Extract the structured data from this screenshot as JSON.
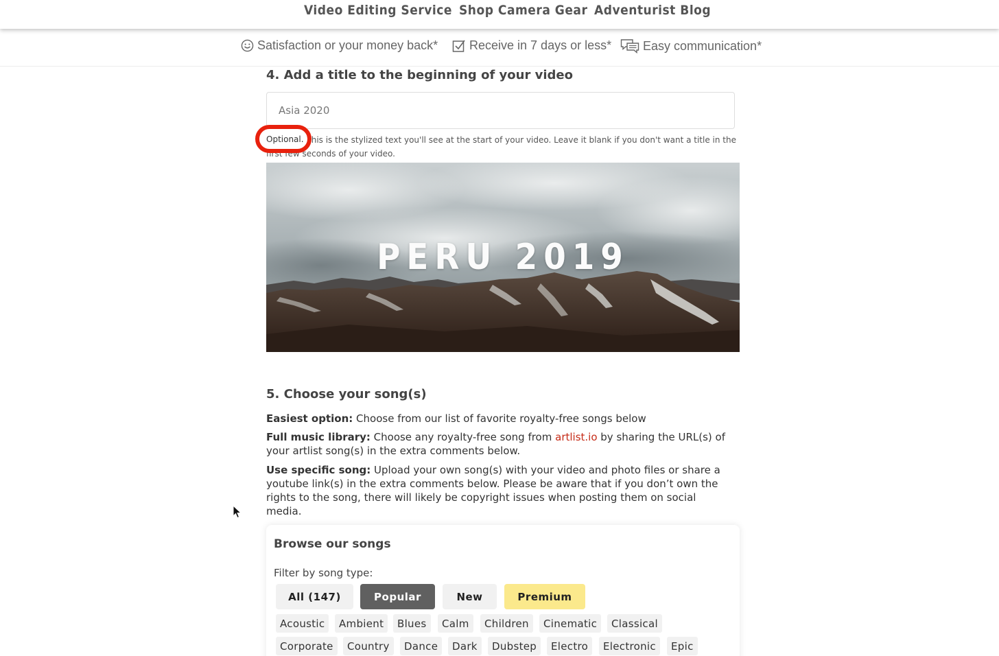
{
  "nav": {
    "items": [
      "Video Editing Service",
      "Shop Camera Gear",
      "Adventurist Blog"
    ]
  },
  "guarantees": [
    {
      "icon": "smiley-icon",
      "text": "Satisfaction or your money back*"
    },
    {
      "icon": "checkbox-icon",
      "text": "Receive in 7 days or less*"
    },
    {
      "icon": "chat-bubbles-icon",
      "text": "Easy communication*"
    }
  ],
  "section4": {
    "title": "4. Add a title to the beginning of your video",
    "input_value": "Asia 2020",
    "optional_label": "Optional.",
    "helper_text": "This is the stylized text you'll see at the start of your video. Leave it blank if you don't want a title in the first few seconds of your video.",
    "highlight_color": "#e8210d",
    "preview_title": "PERU 2019"
  },
  "section5": {
    "title": "5. Choose your song(s)",
    "easiest_label": "Easiest option:",
    "easiest_text": " Choose from our list of favorite royalty-free songs below",
    "full_label": "Full music library:",
    "full_text_before": " Choose any royalty-free song from ",
    "full_link": "artlist.io",
    "full_text_after": " by sharing the URL(s) of your artlist song(s) in the extra comments below.",
    "specific_label": "Use specific song:",
    "specific_text": " Upload your own song(s) with your video and photo files or share a youtube link(s) in the extra comments below. Please be aware that if you don’t own the rights to the song, there will likely be copyright issues when posting them on social media.",
    "link_color": "#c62b17"
  },
  "browse": {
    "title": "Browse our songs",
    "filter_label": "Filter by song type:",
    "filters": {
      "all": "All (147)",
      "popular": "Popular",
      "new": "New",
      "premium": "Premium"
    },
    "selected_filter": "Popular",
    "genres_row1": [
      "Acoustic",
      "Ambient",
      "Blues",
      "Calm",
      "Children",
      "Cinematic",
      "Classical"
    ],
    "genres_row2": [
      "Corporate",
      "Country",
      "Dance",
      "Dark",
      "Dubstep",
      "Electro",
      "Electronic",
      "Epic"
    ]
  }
}
